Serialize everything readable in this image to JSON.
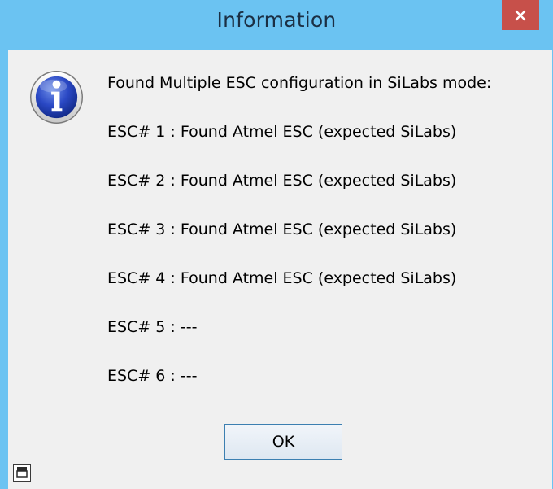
{
  "window": {
    "title": "Information",
    "close_icon": "close-icon"
  },
  "message": {
    "icon": "info-icon",
    "lines": [
      "Found Multiple ESC configuration in SiLabs mode:",
      "ESC# 1 : Found Atmel ESC (expected SiLabs)",
      "ESC# 2 : Found Atmel ESC (expected SiLabs)",
      "ESC# 3 : Found Atmel ESC (expected SiLabs)",
      "ESC# 4 : Found Atmel ESC (expected SiLabs)",
      "ESC# 5 :  ---",
      "ESC# 6 :  ---"
    ]
  },
  "buttons": {
    "ok_label": "OK"
  },
  "footer": {
    "corner_icon": "window-restore-icon"
  },
  "colors": {
    "titlebar": "#6bc3f2",
    "close_button": "#c7504a",
    "client_background": "#f0f0f0",
    "button_border": "#3c7fb1"
  }
}
